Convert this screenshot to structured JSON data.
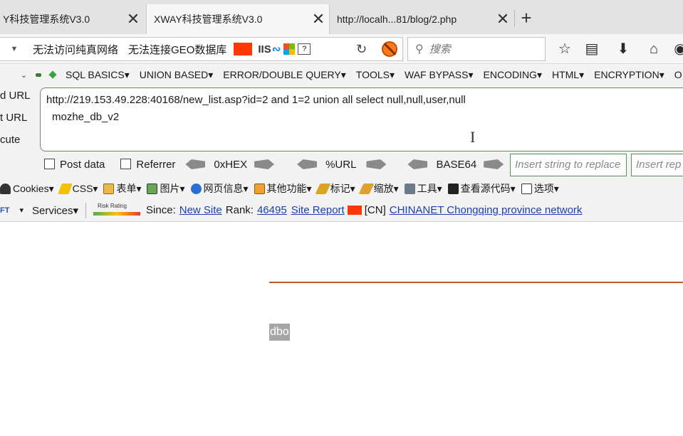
{
  "tabs": [
    {
      "title": "Y科技管理系统V3.0",
      "close": "✕"
    },
    {
      "title": "XWAY科技管理系统V3.0",
      "close": "✕"
    },
    {
      "title": "http://localh...81/blog/2.php",
      "close": "✕"
    }
  ],
  "new_tab": "+",
  "navbar": {
    "geo_text_1": "无法访问纯真网络",
    "geo_text_2": "无法连接GEO数据库",
    "iis_label": "IIS",
    "iis_wave": "∾",
    "qmark": "?",
    "reload_icon": "↻",
    "search_placeholder": "搜索",
    "search_icon": "⚲",
    "icons": [
      "star-icon",
      "reading-list-icon",
      "download-icon",
      "home-icon",
      "account-icon"
    ]
  },
  "hackbar": {
    "menu": [
      "SQL BASICS",
      "UNION BASED",
      "ERROR/DOUBLE QUERY",
      "TOOLS",
      "WAF BYPASS",
      "ENCODING",
      "HTML",
      "ENCRYPTION",
      "O"
    ],
    "side_labels": [
      "d URL",
      "t URL",
      "cute"
    ],
    "url_line1": "http://219.153.49.228:40168/new_list.asp?id=2 and 1=2 union all select null,null,user,null",
    "url_line2": "mozhe_db_v2",
    "post_data": "Post data",
    "referrer": "Referrer",
    "hex": "0xHEX",
    "url_enc": "%URL",
    "base64": "BASE64",
    "replace_placeholder_1": "Insert string to replace",
    "replace_placeholder_2": "Insert rep"
  },
  "webdev": {
    "items": [
      "Cookies",
      "CSS",
      "表单",
      "图片",
      "网页信息",
      "其他功能",
      "标记",
      "缩放",
      "工具",
      "查看源代码",
      "选项"
    ]
  },
  "sitebar": {
    "logo": "FT",
    "services": "Services",
    "risk_label": "Risk Rating",
    "since_label": "Since:",
    "since_value": "New Site",
    "rank_label": "Rank:",
    "rank_value": "46495",
    "site_report": "Site Report",
    "country": "[CN]",
    "network": "CHINANET Chongqing province network"
  },
  "page": {
    "result": "dbo"
  },
  "colors": {
    "accent_line": "#c0592a",
    "link": "#1a3fb0",
    "flag_cn": "#ff3a00"
  }
}
